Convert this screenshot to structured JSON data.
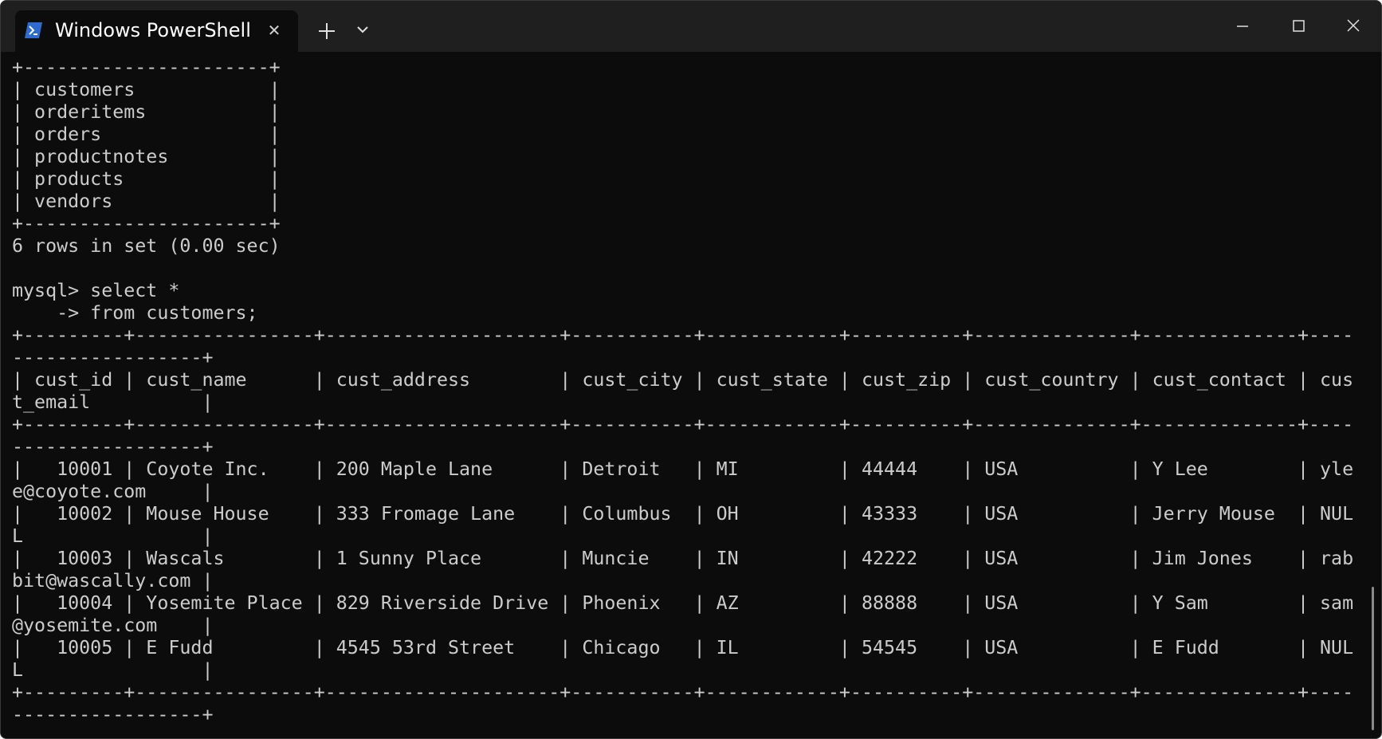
{
  "tab": {
    "title": "Windows PowerShell",
    "icon": "powershell-icon",
    "close_glyph": "✕"
  },
  "window_controls": [
    "minimize-icon",
    "maximize-icon",
    "close-icon"
  ],
  "colors": {
    "terminal_bg": "#0c0c0c",
    "titlebar_bg": "#1f1f1f",
    "text": "#cccccc",
    "powershell_blue": "#2d6bd1"
  },
  "terminal": {
    "lines": [
      "+----------------------+",
      "| customers            |",
      "| orderitems           |",
      "| orders               |",
      "| productnotes         |",
      "| products             |",
      "| vendors              |",
      "+----------------------+",
      "6 rows in set (0.00 sec)",
      "",
      "mysql> select *",
      "    -> from customers;",
      "+---------+----------------+---------------------+-----------+------------+----------+--------------+--------------+----",
      "-----------------+",
      "| cust_id | cust_name      | cust_address        | cust_city | cust_state | cust_zip | cust_country | cust_contact | cus",
      "t_email          |",
      "+---------+----------------+---------------------+-----------+------------+----------+--------------+--------------+----",
      "-----------------+",
      "|   10001 | Coyote Inc.    | 200 Maple Lane      | Detroit   | MI         | 44444    | USA          | Y Lee        | yle",
      "e@coyote.com     |",
      "|   10002 | Mouse House    | 333 Fromage Lane    | Columbus  | OH         | 43333    | USA          | Jerry Mouse  | NUL",
      "L                |",
      "|   10003 | Wascals        | 1 Sunny Place       | Muncie    | IN         | 42222    | USA          | Jim Jones    | rab",
      "bit@wascally.com |",
      "|   10004 | Yosemite Place | 829 Riverside Drive | Phoenix   | AZ         | 88888    | USA          | Y Sam        | sam",
      "@yosemite.com    |",
      "|   10005 | E Fudd         | 4545 53rd Street    | Chicago   | IL         | 54545    | USA          | E Fudd       | NUL",
      "L                |",
      "+---------+----------------+---------------------+-----------+------------+----------+--------------+--------------+----",
      "-----------------+"
    ]
  }
}
